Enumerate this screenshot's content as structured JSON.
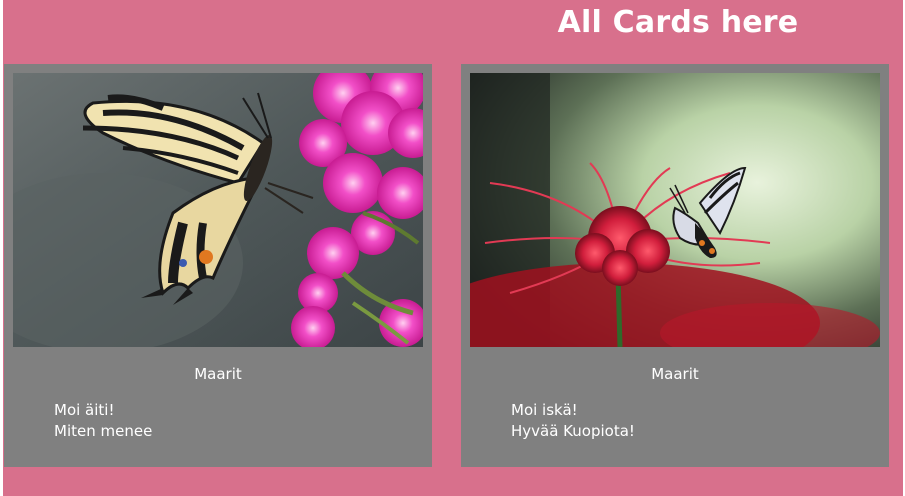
{
  "header": {
    "title": "All Cards here"
  },
  "cards": [
    {
      "image": "butterfly-pink-flowers-photo",
      "author": "Maarit",
      "message_lines": [
        "Moi äiti!",
        "Miten menee"
      ]
    },
    {
      "image": "butterfly-red-lily-photo",
      "author": "Maarit",
      "message_lines": [
        "Moi iskä!",
        "Hyvää Kuopiota!"
      ]
    }
  ],
  "colors": {
    "page_background": "#d8708c",
    "card_background": "#808080",
    "text": "#ffffff"
  }
}
